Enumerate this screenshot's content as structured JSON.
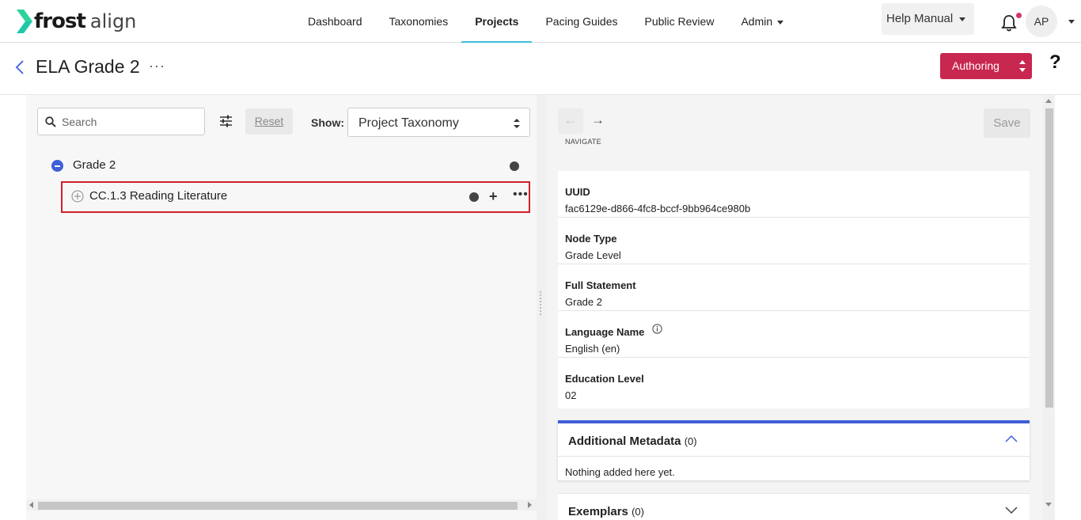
{
  "brand": {
    "name_bold": "frost",
    "name_light": "align"
  },
  "nav": {
    "items": [
      {
        "label": "Dashboard"
      },
      {
        "label": "Taxonomies"
      },
      {
        "label": "Projects"
      },
      {
        "label": "Pacing Guides"
      },
      {
        "label": "Public Review"
      },
      {
        "label": "Admin"
      }
    ],
    "active": "Projects"
  },
  "header_right": {
    "help_label": "Help Manual",
    "avatar_initials": "AP"
  },
  "page": {
    "title": "ELA Grade 2",
    "more": "···",
    "mode_label": "Authoring",
    "help_glyph": "?"
  },
  "left": {
    "search_placeholder": "Search",
    "reset_label": "Reset",
    "show_label": "Show:",
    "show_value": "Project Taxonomy",
    "tree": [
      {
        "label": "Grade 2"
      },
      {
        "label": "CC.1.3 Reading Literature"
      }
    ]
  },
  "right": {
    "navigate_label": "NAVIGATE",
    "save_label": "Save",
    "fields": [
      {
        "key": "UUID",
        "value": "fac6129e-d866-4fc8-bccf-9bb964ce980b"
      },
      {
        "key": "Node Type",
        "value": "Grade Level"
      },
      {
        "key": "Full Statement",
        "value": "Grade 2"
      },
      {
        "key": "Language Name",
        "value": "English (en)"
      },
      {
        "key": "Education Level",
        "value": "02"
      }
    ],
    "additional_metadata": {
      "title": "Additional Metadata",
      "count": "(0)",
      "empty_text": "Nothing added here yet."
    },
    "exemplars": {
      "title": "Exemplars",
      "count": "(0)"
    }
  },
  "colors": {
    "accent": "#3fbde0",
    "authoring": "#c8274f",
    "tree_minus": "#3f5fd8",
    "selection_border": "#d21f2a"
  },
  "icons": [
    "logo-chevron-icon",
    "bell-icon",
    "back-arrow-icon",
    "search-icon",
    "filter-icon",
    "select-arrows-icon",
    "minus-circle-icon",
    "plus-circle-icon",
    "add-icon",
    "more-icon",
    "arrow-left-icon",
    "arrow-right-icon",
    "info-icon",
    "chevron-up-icon",
    "chevron-down-icon"
  ]
}
